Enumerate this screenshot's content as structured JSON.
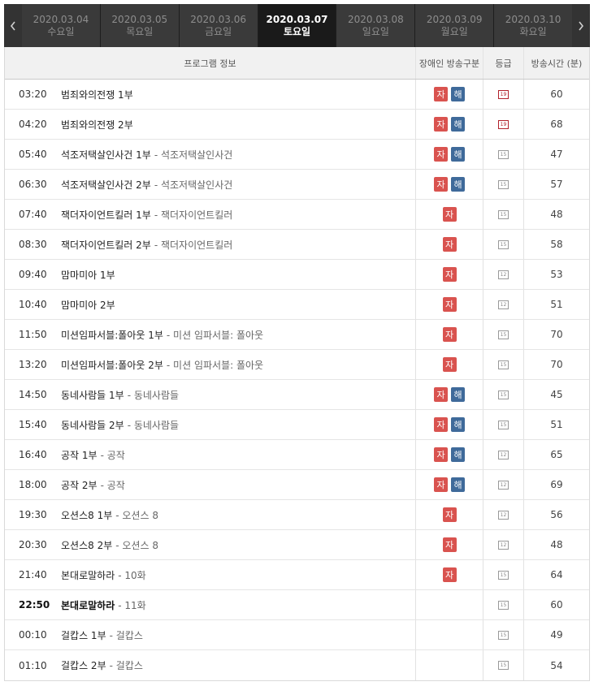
{
  "nav": {
    "days": [
      {
        "date": "2020.03.04",
        "weekday": "수요일",
        "active": false
      },
      {
        "date": "2020.03.05",
        "weekday": "목요일",
        "active": false
      },
      {
        "date": "2020.03.06",
        "weekday": "금요일",
        "active": false
      },
      {
        "date": "2020.03.07",
        "weekday": "토요일",
        "active": true
      },
      {
        "date": "2020.03.08",
        "weekday": "일요일",
        "active": false
      },
      {
        "date": "2020.03.09",
        "weekday": "월요일",
        "active": false
      },
      {
        "date": "2020.03.10",
        "weekday": "화요일",
        "active": false
      }
    ]
  },
  "table": {
    "headers": {
      "info": "프로그램 정보",
      "accessibility": "장애인 방송구분",
      "grade": "등급",
      "duration": "방송시간 (분)"
    },
    "rows": [
      {
        "time": "03:20",
        "title": "범죄와의전쟁 1부",
        "subtitle": "",
        "ja": true,
        "hae": true,
        "grade": "19",
        "duration": "60"
      },
      {
        "time": "04:20",
        "title": "범죄와의전쟁 2부",
        "subtitle": "",
        "ja": true,
        "hae": true,
        "grade": "19",
        "duration": "68"
      },
      {
        "time": "05:40",
        "title": "석조저택살인사건 1부",
        "subtitle": "- 석조저택살인사건",
        "ja": true,
        "hae": true,
        "grade": "15",
        "duration": "47"
      },
      {
        "time": "06:30",
        "title": "석조저택살인사건 2부",
        "subtitle": "- 석조저택살인사건",
        "ja": true,
        "hae": true,
        "grade": "15",
        "duration": "57"
      },
      {
        "time": "07:40",
        "title": "잭더자이언트킬러 1부",
        "subtitle": "- 잭더자이언트킬러",
        "ja": true,
        "hae": false,
        "grade": "15",
        "duration": "48"
      },
      {
        "time": "08:30",
        "title": "잭더자이언트킬러 2부",
        "subtitle": "- 잭더자이언트킬러",
        "ja": true,
        "hae": false,
        "grade": "15",
        "duration": "58"
      },
      {
        "time": "09:40",
        "title": "맘마미아 1부",
        "subtitle": "",
        "ja": true,
        "hae": false,
        "grade": "12",
        "duration": "53"
      },
      {
        "time": "10:40",
        "title": "맘마미아 2부",
        "subtitle": "",
        "ja": true,
        "hae": false,
        "grade": "12",
        "duration": "51"
      },
      {
        "time": "11:50",
        "title": "미션임파서블:폴아웃 1부",
        "subtitle": "- 미션 임파서블: 폴아웃",
        "ja": true,
        "hae": false,
        "grade": "15",
        "duration": "70"
      },
      {
        "time": "13:20",
        "title": "미션임파서블:폴아웃 2부",
        "subtitle": "- 미션 임파서블: 폴아웃",
        "ja": true,
        "hae": false,
        "grade": "15",
        "duration": "70"
      },
      {
        "time": "14:50",
        "title": "동네사람들 1부",
        "subtitle": "- 동네사람들",
        "ja": true,
        "hae": true,
        "grade": "15",
        "duration": "45"
      },
      {
        "time": "15:40",
        "title": "동네사람들 2부",
        "subtitle": "- 동네사람들",
        "ja": true,
        "hae": true,
        "grade": "15",
        "duration": "51"
      },
      {
        "time": "16:40",
        "title": "공작 1부",
        "subtitle": "- 공작",
        "ja": true,
        "hae": true,
        "grade": "12",
        "duration": "65"
      },
      {
        "time": "18:00",
        "title": "공작 2부",
        "subtitle": "- 공작",
        "ja": true,
        "hae": true,
        "grade": "12",
        "duration": "69"
      },
      {
        "time": "19:30",
        "title": "오션스8 1부",
        "subtitle": "- 오션스 8",
        "ja": true,
        "hae": false,
        "grade": "12",
        "duration": "56"
      },
      {
        "time": "20:30",
        "title": "오션스8 2부",
        "subtitle": "- 오션스 8",
        "ja": true,
        "hae": false,
        "grade": "12",
        "duration": "48"
      },
      {
        "time": "21:40",
        "title": "본대로말하라",
        "subtitle": "- 10화",
        "ja": true,
        "hae": false,
        "grade": "15",
        "duration": "64"
      },
      {
        "time": "22:50",
        "title": "본대로말하라",
        "subtitle": "- 11화",
        "ja": false,
        "hae": false,
        "grade": "15",
        "duration": "60",
        "bold": true
      },
      {
        "time": "00:10",
        "title": "걸캅스 1부",
        "subtitle": "- 걸캅스",
        "ja": false,
        "hae": false,
        "grade": "15",
        "duration": "49"
      },
      {
        "time": "01:10",
        "title": "걸캅스 2부",
        "subtitle": "- 걸캅스",
        "ja": false,
        "hae": false,
        "grade": "15",
        "duration": "54"
      }
    ]
  },
  "badges": {
    "ja": "자",
    "hae": "해"
  },
  "icons": {
    "prev": "chevron-left-icon",
    "next": "chevron-right-icon"
  },
  "colors": {
    "ja": "#d9534f",
    "hae": "#3f6a9a",
    "grade19": "#b2202a",
    "nav_bg": "#2b2b2b",
    "nav_active": "#1a1a1a"
  }
}
